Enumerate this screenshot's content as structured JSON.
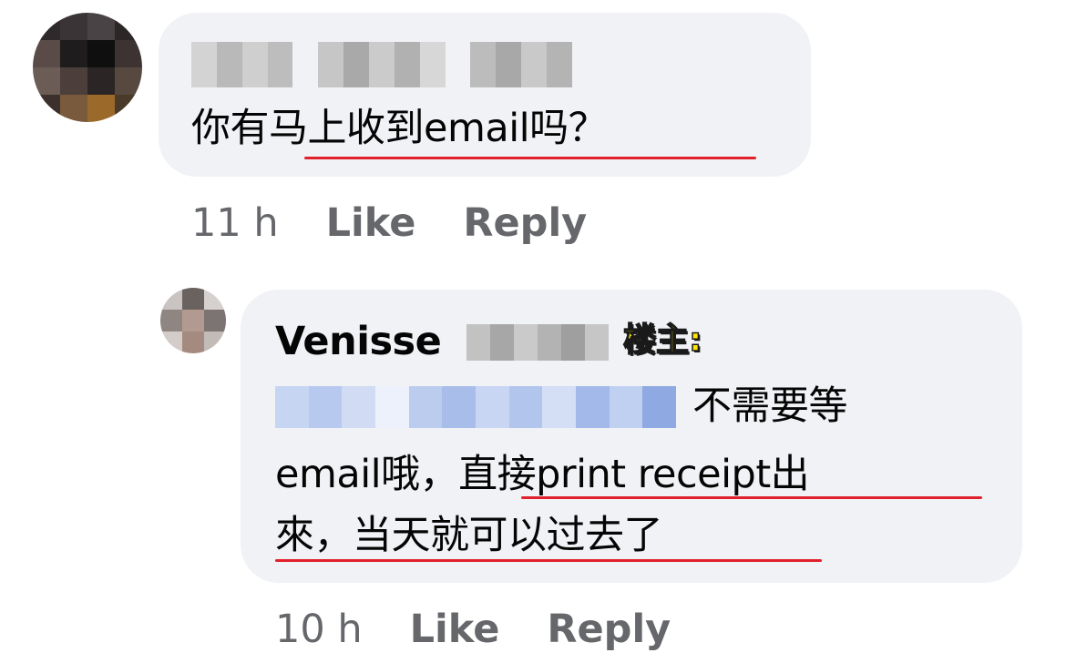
{
  "comment1": {
    "author_blurred": true,
    "text_a": "你有",
    "text_b": "马上收到email吗？",
    "time": "11 h",
    "like": "Like",
    "reply": "Reply"
  },
  "comment2": {
    "author_first": "Venisse",
    "author_last_blurred": true,
    "op_tag": "楼主:",
    "mention_blurred": true,
    "line1_text": "不需要等",
    "line2_a": "email哦，",
    "line2_b": "直接print receipt出",
    "line3": "來，当天就可以过去了",
    "time": "10 h",
    "like": "Like",
    "reply": "Reply"
  },
  "colors": {
    "bubble": "#f0f2f5",
    "underline": "#e0202a",
    "meta": "#65676b",
    "op_tag": "#ffe600",
    "mention": "#c6d5f2"
  }
}
